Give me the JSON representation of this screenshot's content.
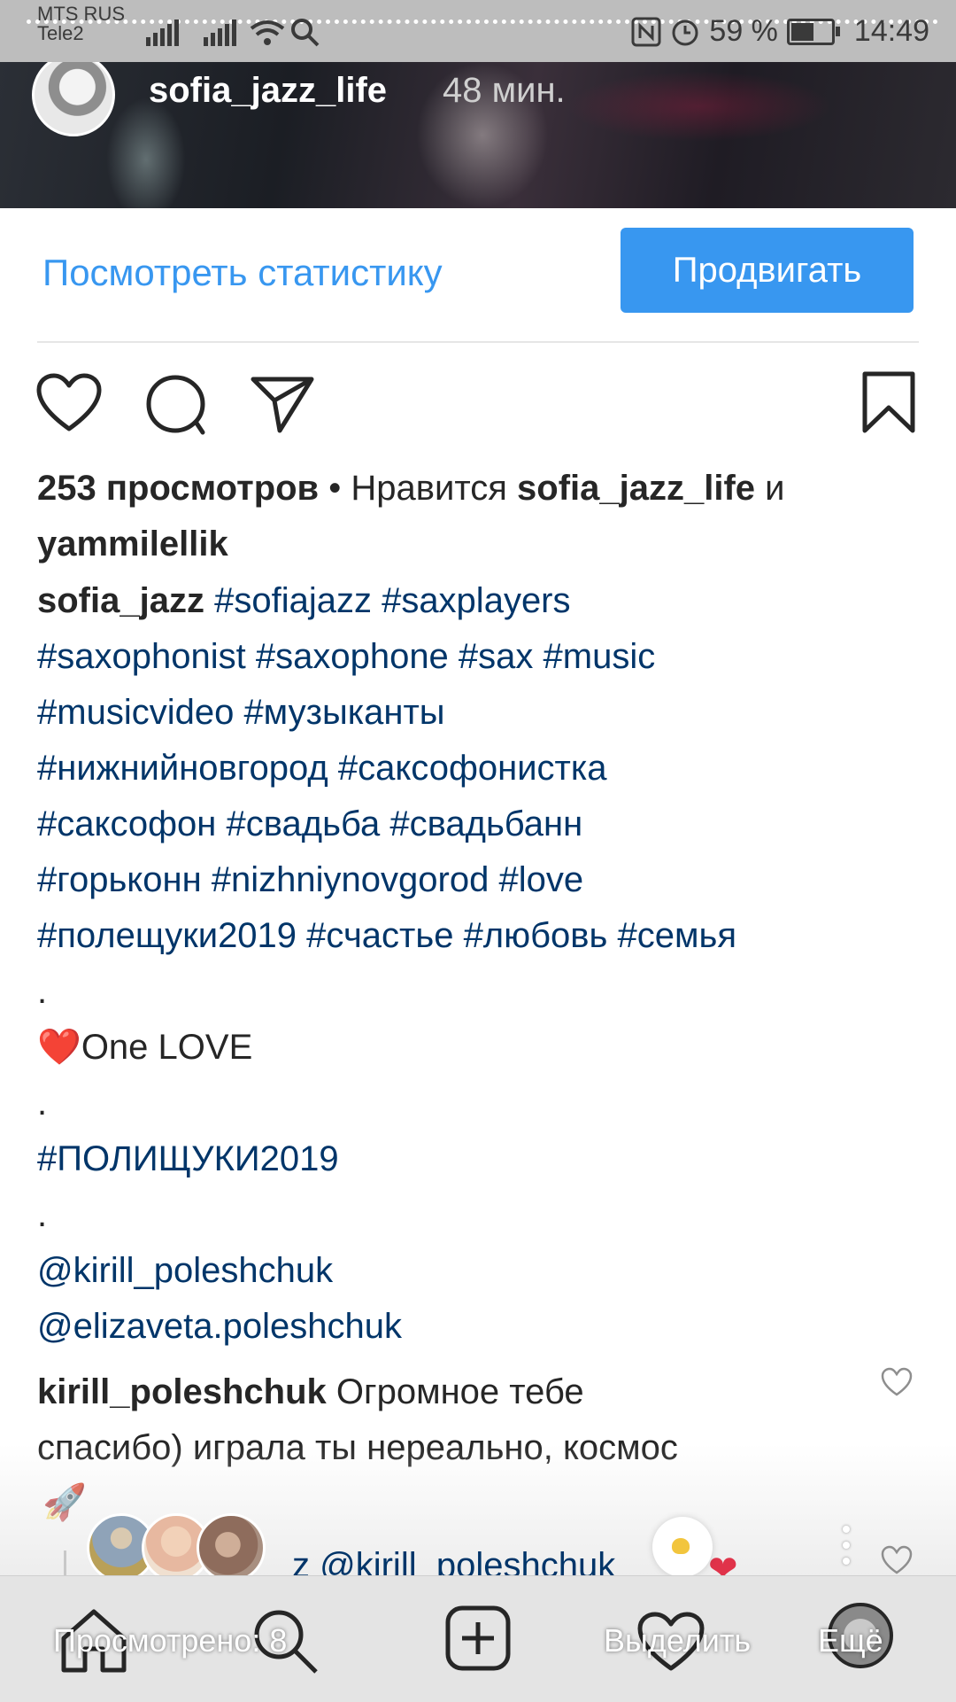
{
  "status_bar": {
    "carrier_1": "MTS RUS",
    "carrier_2": "Tele2",
    "battery_percent": "59 %",
    "battery_level": 0.59,
    "time": "14:49",
    "icons": [
      "signal-icon",
      "signal-icon",
      "wifi-icon",
      "search-icon",
      "nfc-icon",
      "alarm-icon",
      "battery-icon"
    ]
  },
  "story": {
    "username": "sofia_jazz_life",
    "time_ago": "48 мин."
  },
  "insights": {
    "stats_link": "Посмотреть статистику",
    "promote_button": "Продвигать"
  },
  "actions": {
    "icons": [
      "heart-icon",
      "comment-icon",
      "share-icon",
      "bookmark-icon"
    ]
  },
  "engagement": {
    "views": "253 просмотров",
    "separator": " • Нравится ",
    "liker_1": "sofia_jazz_life",
    "and": " и",
    "liker_2": "yammilellik"
  },
  "caption": {
    "author": "sofia_jazz",
    "line_1_tags": " #sofiajazz #saxplayers",
    "line_2": "#saxophonist #saxophone #sax #music",
    "line_3": "#musicvideo #музыканты",
    "line_4": "#нижнийновгород #саксофонистка",
    "line_5": "#саксофон #свадьба #свадьбанн",
    "line_6": "#горьконн #nizhniynovgorod #love",
    "line_7": "#полещуки2019 #счастье #любовь #семья",
    "dot_1": ".",
    "love_emoji": "❤️",
    "love_text": "One LOVE",
    "dot_2": ".",
    "tag_upper": "#ПОЛИЩУКИ2019",
    "dot_3": ".",
    "mention_1": "@kirill_poleshchuk",
    "mention_2": "@elizaveta.poleshchuk"
  },
  "comment": {
    "author": "kirill_poleshchuk",
    "text_1": " Огромное тебе",
    "text_2": "спасибо) играла ты нереально, космос",
    "emoji": "🚀"
  },
  "reply_peek": {
    "text": "z @kirill_poleshchuk",
    "heart": "❤"
  },
  "bottom_nav": {
    "viewed_label": "Просмотрено: 8",
    "highlight_label": "Выделить",
    "more_label": "Ещё",
    "icons": [
      "home-icon",
      "search-icon",
      "add-post-icon",
      "activity-heart-icon",
      "profile-avatar"
    ]
  },
  "colors": {
    "accent_blue": "#3897f0",
    "hashtag_blue": "#003569",
    "text_dark": "#262626"
  }
}
